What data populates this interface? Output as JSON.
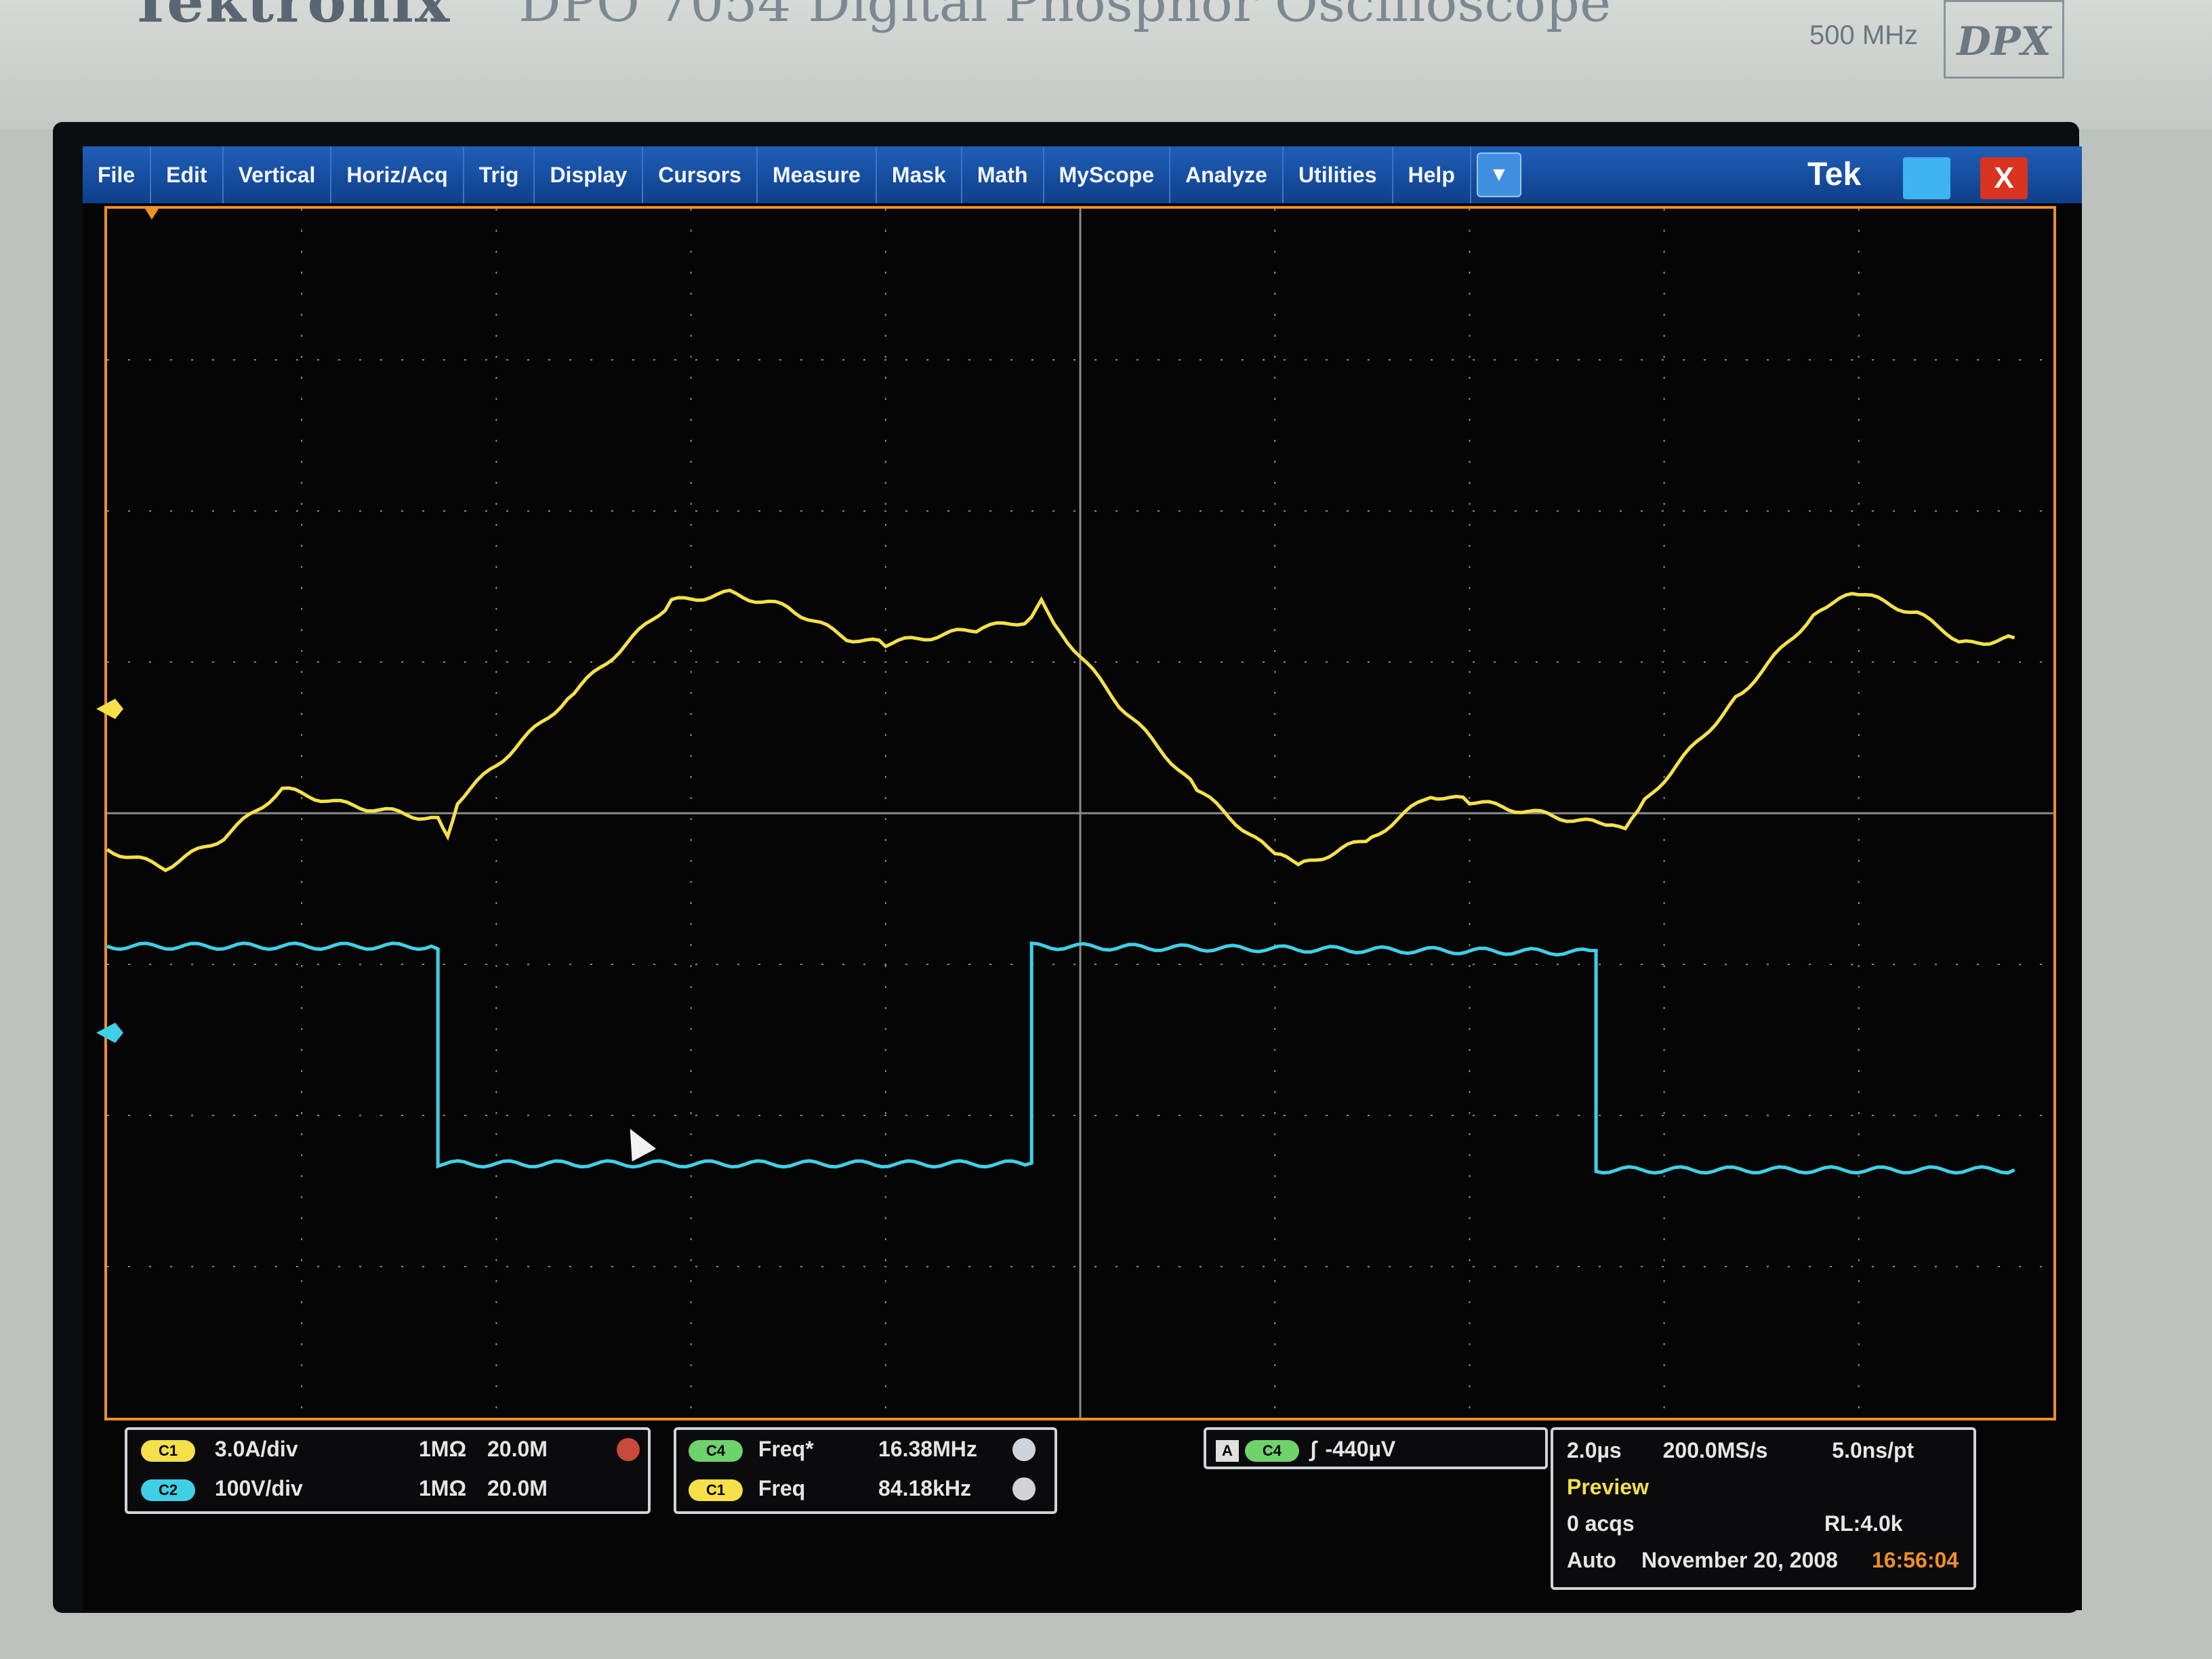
{
  "device": {
    "brand": "Tektronix",
    "model": "DPO 7054",
    "model_description": "Digital Phosphor Oscilloscope",
    "bandwidth": "500 MHz",
    "badge": "DPX"
  },
  "menu": {
    "items": [
      "File",
      "Edit",
      "Vertical",
      "Horiz/Acq",
      "Trig",
      "Display",
      "Cursors",
      "Measure",
      "Mask",
      "Math",
      "MyScope",
      "Analyze",
      "Utilities",
      "Help"
    ],
    "tek_label": "Tek",
    "close_symbol": "X"
  },
  "colors": {
    "menu_bar": "#1a55a8",
    "graticule_border": "#ef8f28",
    "ch1": "#f5e04a",
    "ch2": "#3fd0e6",
    "ch4": "#6ed36a",
    "grid": "#8a8a8a"
  },
  "icons": [
    "menu-dropdown-arrow-icon",
    "minimize-icon",
    "close-icon",
    "ch1-ground-marker-icon",
    "ch2-ground-marker-icon",
    "trigger-marker-icon",
    "mouse-cursor-icon"
  ],
  "channels": [
    {
      "chip": "C1",
      "scale": "3.0A/div",
      "coupling": "1MΩ",
      "bandwidth": "20.0M"
    },
    {
      "chip": "C2",
      "scale": "100V/div",
      "coupling": "1MΩ",
      "bandwidth": "20.0M"
    }
  ],
  "measurements": [
    {
      "chip": "C4",
      "label": "Freq*",
      "value": "16.38MHz"
    },
    {
      "chip": "C1",
      "label": "Freq",
      "value": "84.18kHz"
    }
  ],
  "trigger": {
    "mode_chip": "A",
    "source_chip": "C4",
    "level": "-440µV"
  },
  "acquisition": {
    "time_per_div": "2.0µs",
    "sample_rate": "200.0MS/s",
    "resolution": "5.0ns/pt",
    "state": "Preview",
    "acqs": "0 acqs",
    "record_length": "RL:4.0k",
    "mode": "Auto",
    "date": "November 20, 2008",
    "time": "16:56:04"
  }
}
